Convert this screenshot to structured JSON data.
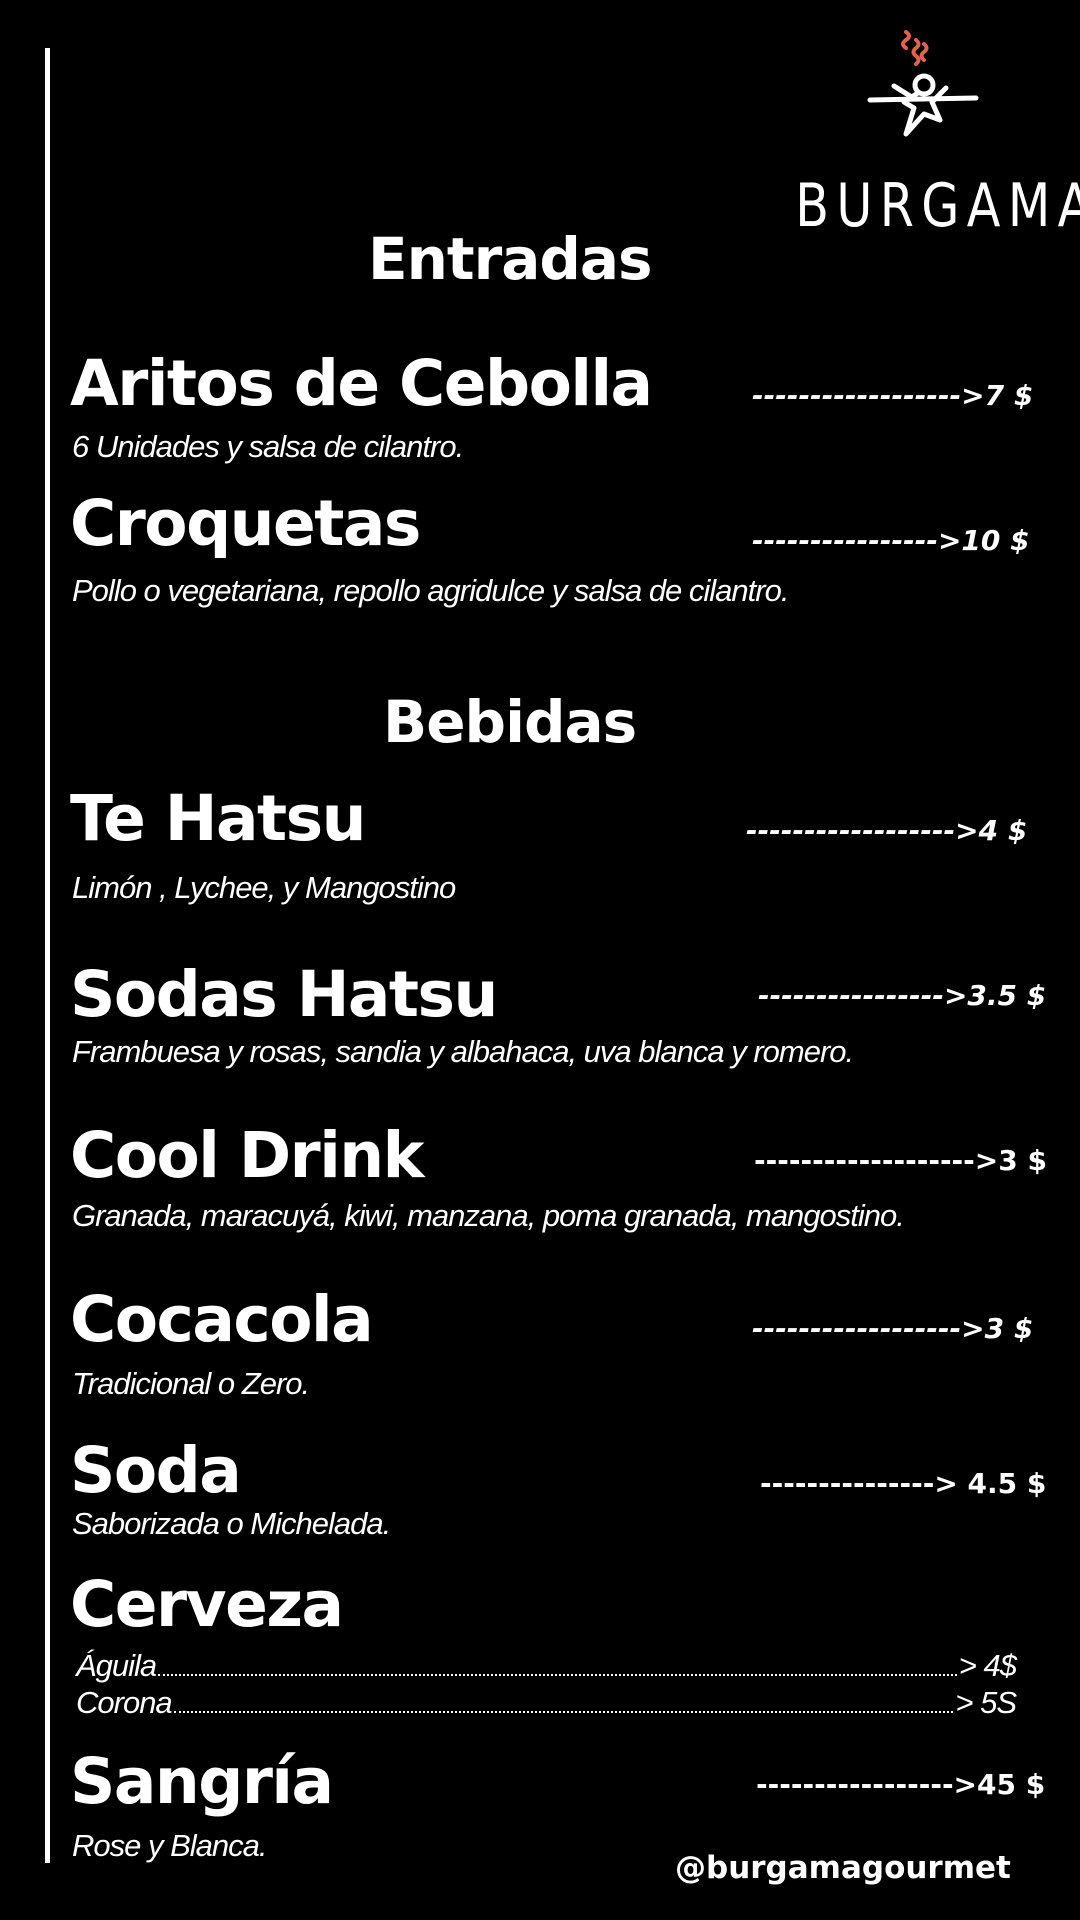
{
  "brand": {
    "name": "BURGAMA",
    "handle": "@burgamagourmet",
    "steam_color": "#e0624f"
  },
  "sections": {
    "entradas": "Entradas",
    "bebidas": "Bebidas"
  },
  "items": {
    "aritos": {
      "name": "Aritos de Cebolla",
      "price": "------------------>7 $",
      "desc": "6 Unidades y salsa de cilantro."
    },
    "croquetas": {
      "name": "Croquetas",
      "price": "---------------->10 $",
      "desc": "Pollo  o vegetariana, repollo agridulce y salsa de cilantro."
    },
    "te_hatsu": {
      "name": "Te Hatsu",
      "price": "------------------>4 $",
      "desc": "Limón , Lychee, y Mangostino"
    },
    "sodas_hatsu": {
      "name": "Sodas Hatsu",
      "price": "---------------->3.5 $",
      "desc": "Frambuesa y rosas, sandia y albahaca, uva blanca y romero."
    },
    "cool_drink": {
      "name": "Cool Drink",
      "price": "------------------->3 $",
      "desc": "Granada, maracuyá, kiwi, manzana, poma granada, mangostino."
    },
    "cocacola": {
      "name": "Cocacola",
      "price": "------------------>3 $",
      "desc": "Tradicional  o Zero."
    },
    "soda": {
      "name": "Soda",
      "price": "---------------> 4.5 $",
      "desc": "Saborizada o Michelada."
    },
    "cerveza": {
      "name": "Cerveza",
      "aguila_name": "Águila",
      "aguila_price": "> 4$",
      "corona_name": "Corona",
      "corona_price": "> 5S"
    },
    "sangria": {
      "name": "Sangría",
      "price": "----------------->45 $",
      "desc": "Rose y Blanca."
    }
  }
}
